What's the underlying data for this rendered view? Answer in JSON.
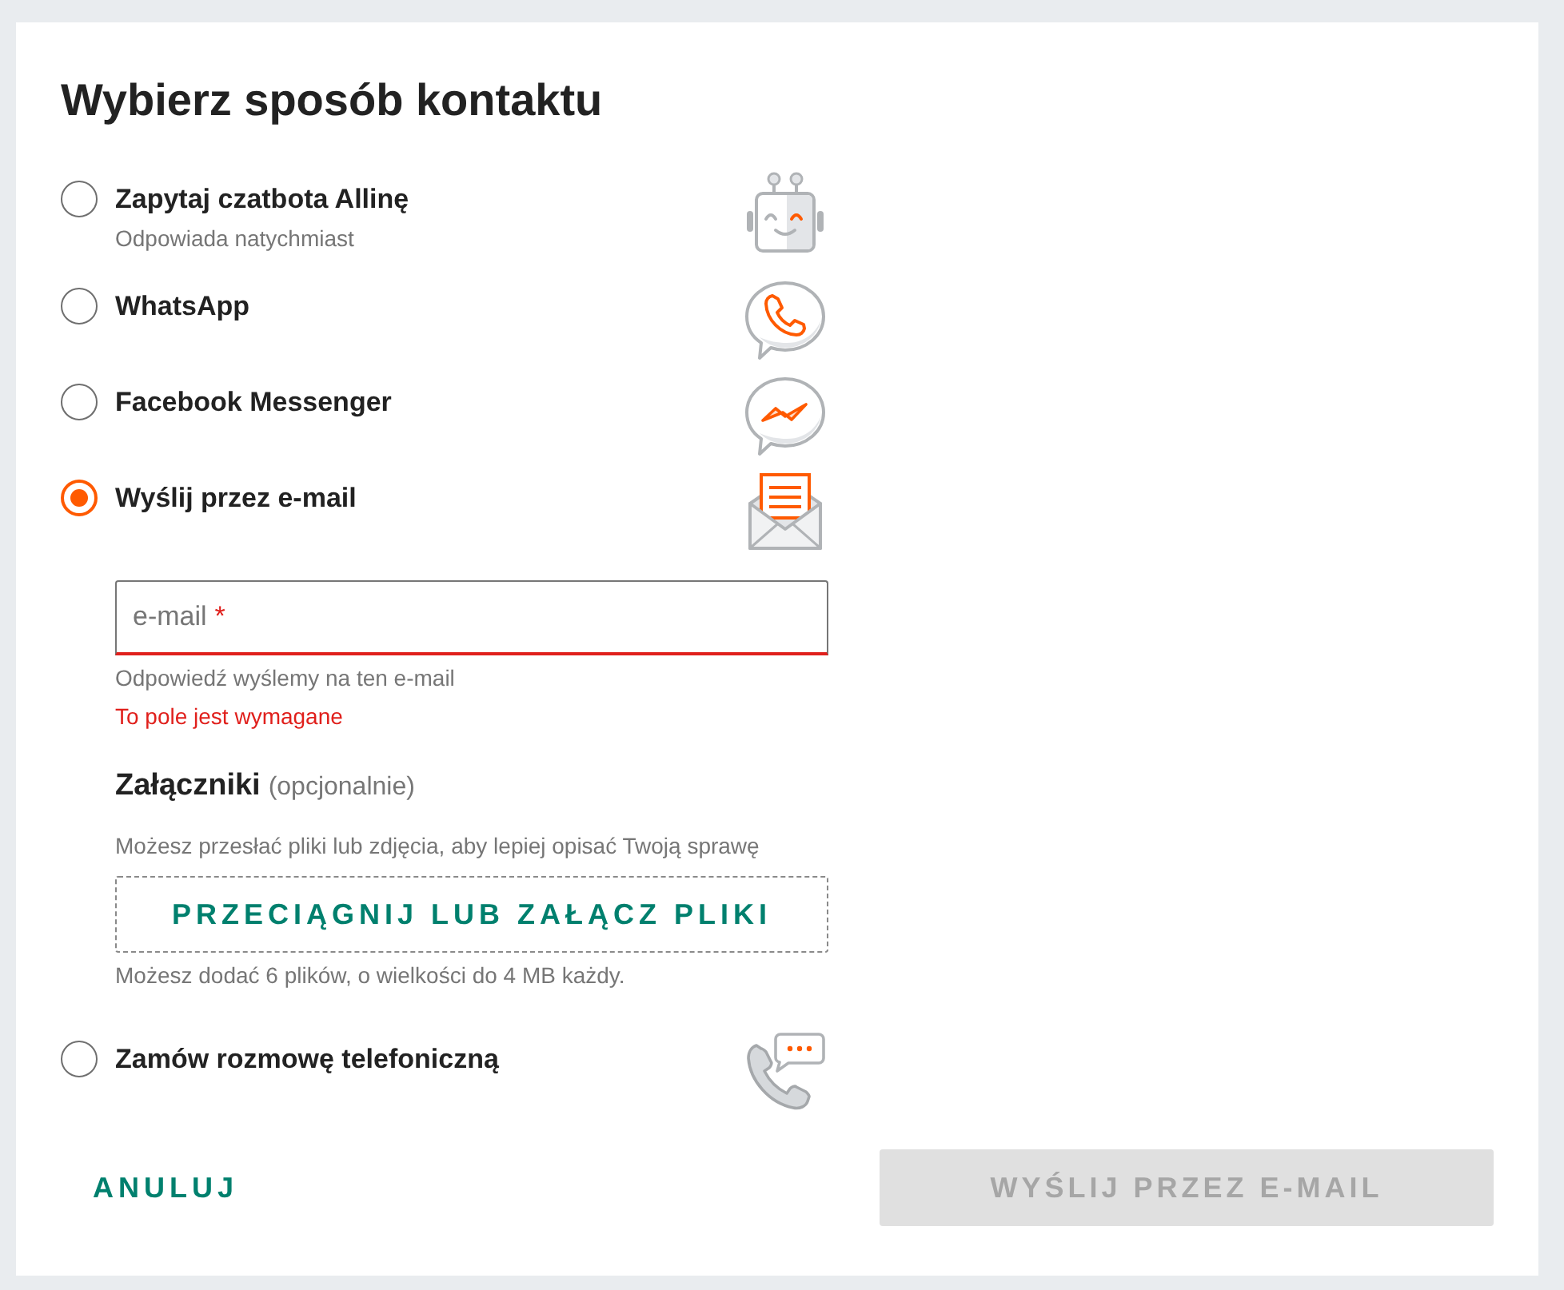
{
  "title": "Wybierz sposób kontaktu",
  "options": [
    {
      "kind": "chatbot",
      "label": "Zapytaj czatbota Allinę",
      "description": "Odpowiada natychmiast",
      "selected": false
    },
    {
      "kind": "whatsapp",
      "label": "WhatsApp",
      "selected": false
    },
    {
      "kind": "messenger",
      "label": "Facebook Messenger",
      "selected": false
    },
    {
      "kind": "email",
      "label": "Wyślij przez e-mail",
      "selected": true,
      "form": {
        "email_field": {
          "placeholder": "e-mail",
          "required_mark": "*",
          "invalid": true
        },
        "hint": "Odpowiedź wyślemy na ten e-mail",
        "error": "To pole jest wymagane",
        "attachments": {
          "title": "Załączniki",
          "note": "(opcjonalnie)",
          "description": "Możesz przesłać pliki lub zdjęcia, aby lepiej opisać Twoją sprawę",
          "dropzone": "PRZECIĄGNIJ LUB ZAŁĄCZ PLIKI",
          "limits": "Możesz dodać 6 plików, o wielkości do 4 MB każdy."
        }
      }
    },
    {
      "kind": "callback",
      "label": "Zamów rozmowę telefoniczną",
      "selected": false
    }
  ],
  "actions": [
    {
      "kind": "text",
      "label": "ANULUJ",
      "disabled": false
    },
    {
      "kind": "primary",
      "label": "WYŚLIJ PRZEZ E-MAIL",
      "disabled": true
    }
  ]
}
